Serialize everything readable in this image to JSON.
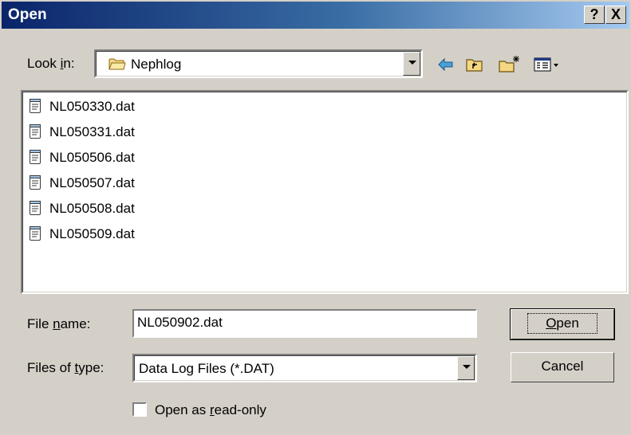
{
  "window": {
    "title": "Open",
    "help_button": "?",
    "close_button": "X"
  },
  "look_in": {
    "label_pre": "Look ",
    "label_accel": "i",
    "label_post": "n:",
    "value": "Nephlog"
  },
  "toolbar": {
    "icons": [
      "back-arrow-icon",
      "up-one-level-icon",
      "create-new-folder-icon",
      "view-menu-icon"
    ]
  },
  "files": [
    {
      "name": "NL050330.dat"
    },
    {
      "name": "NL050331.dat"
    },
    {
      "name": "NL050506.dat"
    },
    {
      "name": "NL050507.dat"
    },
    {
      "name": "NL050508.dat"
    },
    {
      "name": "NL050509.dat"
    }
  ],
  "file_name": {
    "label_pre": "File ",
    "label_accel": "n",
    "label_post": "ame:",
    "value": "NL050902.dat"
  },
  "file_type": {
    "label_pre": "Files of ",
    "label_accel": "t",
    "label_post": "ype:",
    "value": "Data Log Files (*.DAT)"
  },
  "buttons": {
    "open_accel": "O",
    "open_rest": "pen",
    "cancel": "Cancel"
  },
  "read_only": {
    "label_pre": "Open as ",
    "label_accel": "r",
    "label_post": "ead-only",
    "checked": false
  },
  "colors": {
    "title_start": "#0a246a",
    "title_end": "#a6caf0",
    "face": "#d4d0c8"
  }
}
